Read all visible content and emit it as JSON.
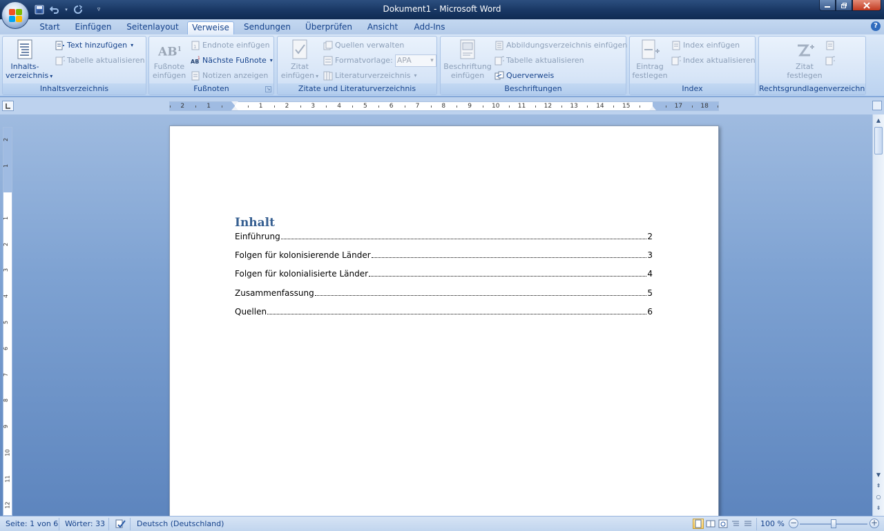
{
  "window": {
    "title": "Dokument1 - Microsoft Word"
  },
  "quick_access": {
    "icons": [
      "save-icon",
      "undo-icon",
      "redo-icon",
      "customize-icon"
    ]
  },
  "tabs": [
    {
      "label": "Start"
    },
    {
      "label": "Einfügen"
    },
    {
      "label": "Seitenlayout"
    },
    {
      "label": "Verweise"
    },
    {
      "label": "Sendungen"
    },
    {
      "label": "Überprüfen"
    },
    {
      "label": "Ansicht"
    },
    {
      "label": "Add-Ins"
    }
  ],
  "active_tab": "Verweise",
  "ribbon": {
    "inhaltsverzeichnis": {
      "label": "Inhaltsverzeichnis",
      "big_button_line1": "Inhalts-",
      "big_button_line2": "verzeichnis",
      "text_hinzufuegen": "Text hinzufügen",
      "tabelle_aktualisieren": "Tabelle aktualisieren"
    },
    "fussnoten": {
      "label": "Fußnoten",
      "big_button_line1": "Fußnote",
      "big_button_line2": "einfügen",
      "big_icon_text": "AB",
      "big_icon_sup": "1",
      "endnote": "Endnote einfügen",
      "naechste": "Nächste Fußnote",
      "notizen": "Notizen anzeigen"
    },
    "zitate": {
      "label": "Zitate und Literaturverzeichnis",
      "big_button_line1": "Zitat",
      "big_button_line2": "einfügen",
      "quellen": "Quellen verwalten",
      "formatvorlage": "Formatvorlage:",
      "formatvorlage_value": "APA",
      "literatur": "Literaturverzeichnis"
    },
    "beschriftungen": {
      "label": "Beschriftungen",
      "big_button_line1": "Beschriftung",
      "big_button_line2": "einfügen",
      "abbildung": "Abbildungsverzeichnis einfügen",
      "tabelle": "Tabelle aktualisieren",
      "querverweis": "Querverweis"
    },
    "index": {
      "label": "Index",
      "big_button_line1": "Eintrag",
      "big_button_line2": "festlegen",
      "index_einfuegen": "Index einfügen",
      "index_aktualisieren": "Index aktualisieren"
    },
    "rechtsgrundlagen": {
      "label": "Rechtsgrundlagenverzeichnis",
      "big_button_line1": "Zitat",
      "big_button_line2": "festlegen"
    }
  },
  "ruler": {
    "h_numbers": [
      "2",
      "1",
      "1",
      "2",
      "3",
      "4",
      "5",
      "6",
      "7",
      "8",
      "9",
      "10",
      "11",
      "12",
      "13",
      "14",
      "15",
      "17",
      "18"
    ],
    "v_numbers": [
      "2",
      "1",
      "1",
      "2",
      "3",
      "4",
      "5",
      "6",
      "7",
      "8",
      "9",
      "10",
      "11",
      "12"
    ]
  },
  "document": {
    "toc_title": "Inhalt",
    "entries": [
      {
        "text": "Einführung",
        "page": "2"
      },
      {
        "text": "Folgen für kolonisierende Länder",
        "page": "3"
      },
      {
        "text": "Folgen für kolonialisierte Länder",
        "page": "4"
      },
      {
        "text": "Zusammenfassung",
        "page": "5"
      },
      {
        "text": "Quellen",
        "page": "6"
      }
    ]
  },
  "status": {
    "page": "Seite: 1 von 6",
    "words": "Wörter: 33",
    "language": "Deutsch (Deutschland)",
    "zoom": "100 %"
  },
  "colors": {
    "accent": "#15428b",
    "heading": "#365f91",
    "title_bar": "#1a3966"
  }
}
